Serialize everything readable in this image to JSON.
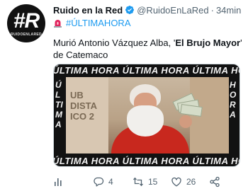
{
  "author": {
    "display_name": "Ruido en la Red",
    "handle": "@RuidoEnLaRed",
    "separator": "·",
    "time": "34min",
    "avatar_mark": "#R",
    "avatar_subtitle": "RUIDOENLARED"
  },
  "tweet": {
    "hashtag": "#ÚLTIMAHORA",
    "text_before": "Murió Antonio Vázquez Alba, '",
    "text_bold": "El Brujo Mayor",
    "text_after": "' de Catemaco"
  },
  "media": {
    "banner_text": "ÚLTIMA HORA ÚLTIMA HORA ÚLTIMA HORA ÚLTIMA HORA ÚLTIMA",
    "banner_side_left": "ÚLTIMA",
    "banner_side_right": "HORA",
    "wall_text": "UB DISTA ICO 2"
  },
  "actions": {
    "views": "",
    "replies": "4",
    "retweets": "15",
    "likes": "26"
  },
  "colors": {
    "accent": "#1d9bf0",
    "muted": "#536471",
    "text": "#0f1419"
  },
  "icons": [
    "verified-badge-icon",
    "siren-icon",
    "analytics-icon",
    "reply-icon",
    "retweet-icon",
    "like-icon",
    "share-icon"
  ]
}
